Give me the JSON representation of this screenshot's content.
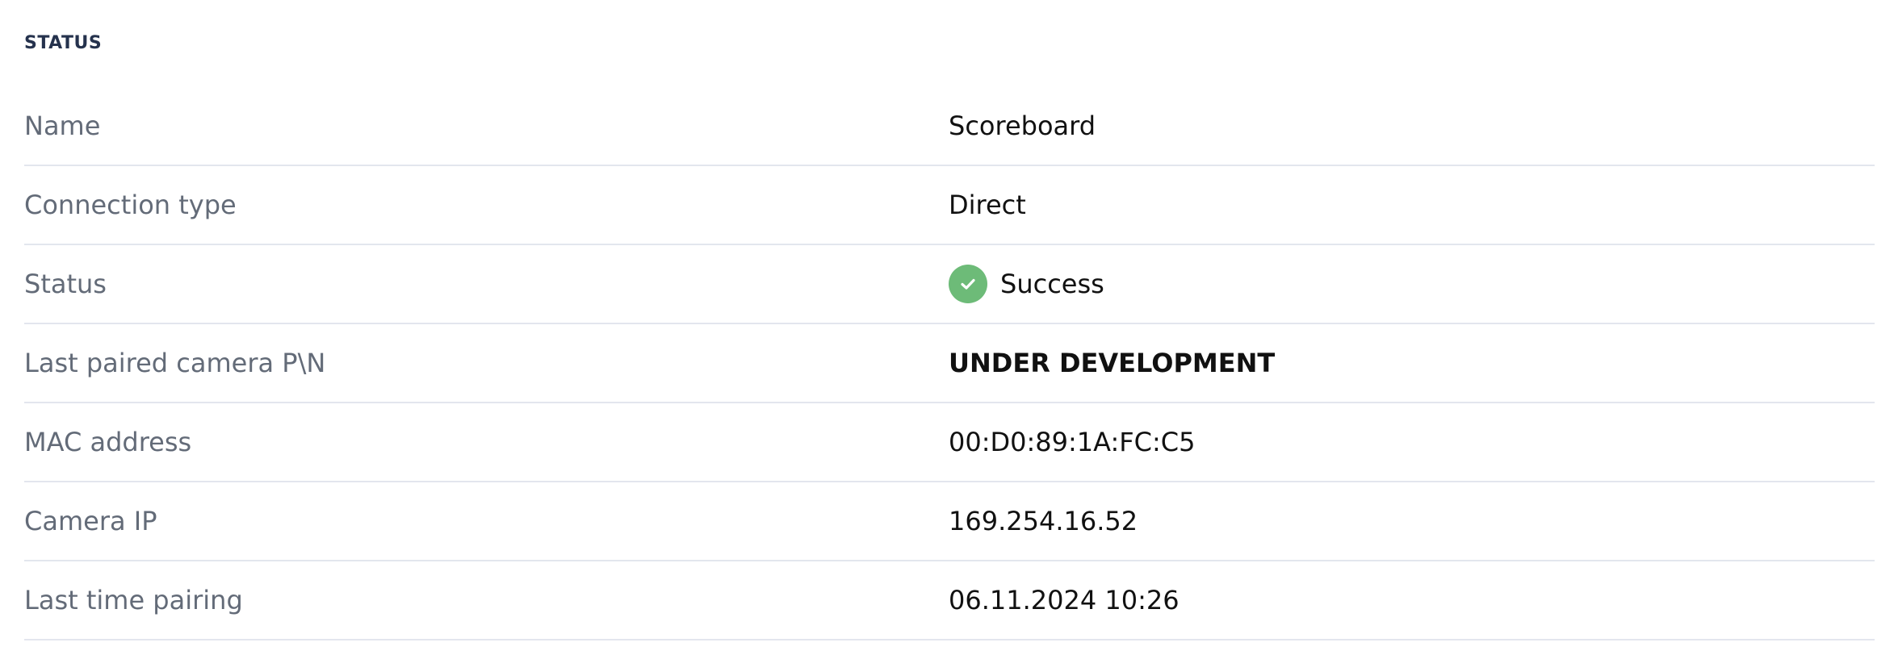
{
  "section": {
    "title": "STATUS"
  },
  "rows": [
    {
      "label": "Name",
      "value": "Scoreboard"
    },
    {
      "label": "Connection type",
      "value": "Direct"
    },
    {
      "label": "Status",
      "value": "Success",
      "icon": "check-circle-icon",
      "icon_color": "#6dbb78"
    },
    {
      "label": "Last paired camera P\\N",
      "value": "UNDER DEVELOPMENT"
    },
    {
      "label": "MAC address",
      "value": "00:D0:89:1A:FC:C5"
    },
    {
      "label": "Camera IP",
      "value": "169.254.16.52"
    },
    {
      "label": "Last time pairing",
      "value": "06.11.2024 10:26"
    }
  ]
}
